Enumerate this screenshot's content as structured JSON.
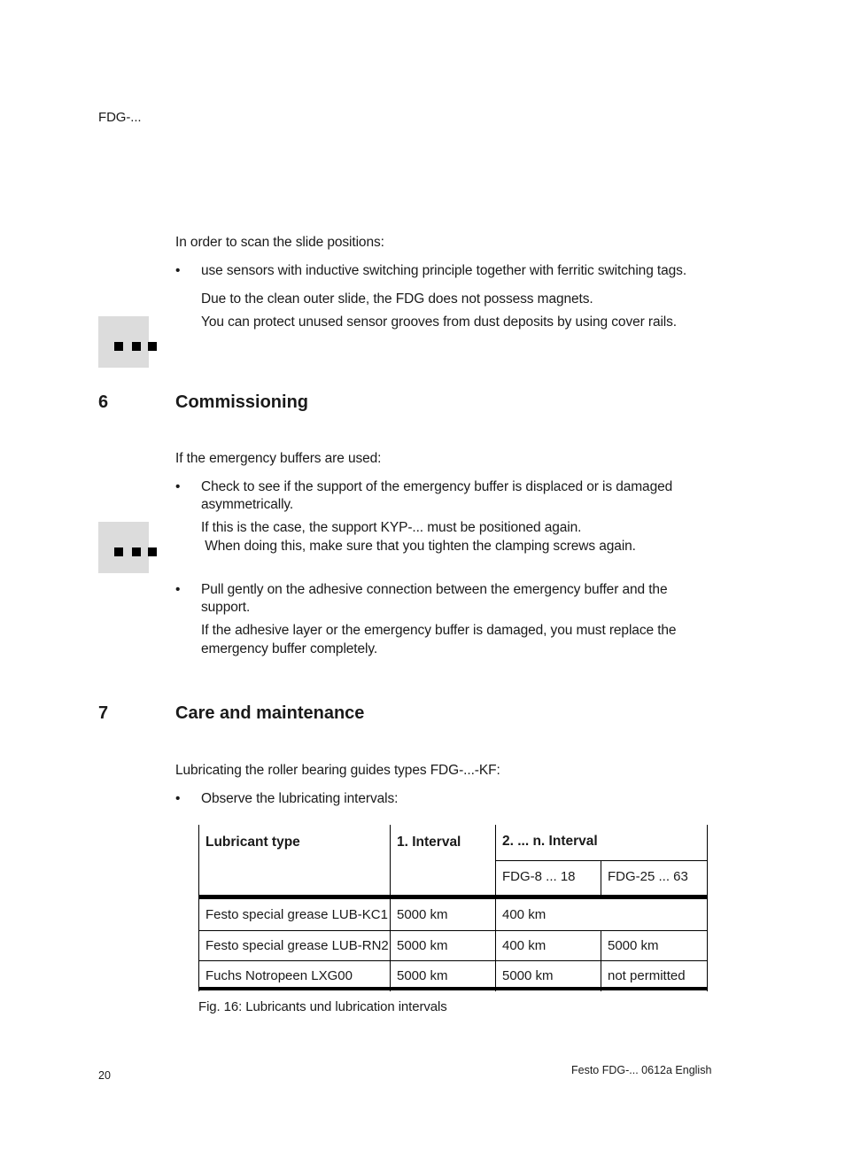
{
  "header": {
    "doc_ref": "FDG-..."
  },
  "intro_section": {
    "lead": "In order to scan the slide positions:",
    "bullet_symbol": "•",
    "bullet": "use sensors with inductive switching principle together with ferritic switching tags.",
    "note_lines": [
      "Due to the clean outer slide, the FDG does not possess magnets.",
      "You can protect unused sensor grooves from dust deposits by using cover rails."
    ],
    "note_icon": "note-icon"
  },
  "section6": {
    "number": "6",
    "title": "Commissioning",
    "lead": "If the emergency buffers are used:",
    "bullets": [
      {
        "lines": [
          "Check to see if the support of the emergency buffer is displaced or is damaged",
          "asymmetrically."
        ],
        "note_lines": [
          "If this is the case, the support KYP-... must be positioned again.",
          " When doing this, make sure that you tighten the clamping screws again."
        ]
      },
      {
        "lines": [
          "Pull gently on the adhesive connection between the emergency buffer and the",
          "support."
        ],
        "note_lines": [
          "If the adhesive layer or the emergency buffer is damaged, you must replace the",
          "emergency buffer completely."
        ]
      }
    ],
    "note_icon": "note-icon"
  },
  "section7": {
    "number": "7",
    "title": "Care and maintenance",
    "lead": "Lubricating the roller bearing guides types FDG-...-KF:",
    "bullet": "Observe the lubricating intervals:"
  },
  "table": {
    "headers": {
      "col1": "Lubricant type",
      "col2": "1. Interval",
      "col3": "2. ... n. Interval",
      "sub1": "FDG-8 ... 18",
      "sub2": "FDG-25 ... 63"
    },
    "rows": [
      {
        "type": "Festo special grease LUB-KC1",
        "first": "5000 km",
        "n_small": "400 km",
        "n_large": ""
      },
      {
        "type": "Festo special grease LUB-RN2",
        "first": "5000 km",
        "n_small": "400 km",
        "n_large": "5000 km"
      },
      {
        "type": "Fuchs Notropeen LXG00",
        "first": "5000 km",
        "n_small": "5000 km",
        "n_large": "not permitted"
      }
    ],
    "caption": "Fig. 16: Lubricants und lubrication intervals"
  },
  "footer": {
    "page_number": "20",
    "doc_info": "Festo FDG-... 0612a English"
  }
}
